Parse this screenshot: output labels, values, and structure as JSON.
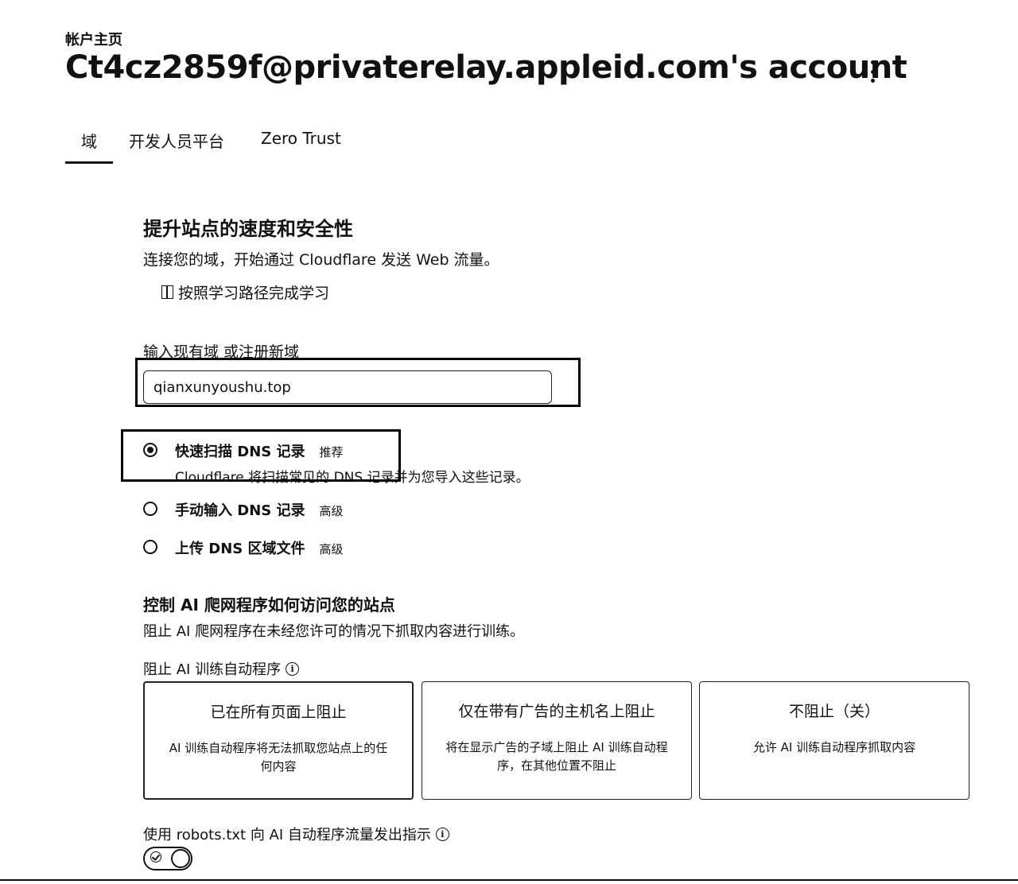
{
  "header": {
    "breadcrumb": "帐户主页",
    "title": "Ct4cz2859f@privaterelay.appleid.com's account",
    "menu_icon": "kebab-icon"
  },
  "tabs": [
    {
      "label": "域",
      "active": true
    },
    {
      "label": "开发人员平台",
      "active": false
    },
    {
      "label": "Zero Trust",
      "active": false
    }
  ],
  "onboarding": {
    "title": "提升站点的速度和安全性",
    "subtitle": "连接您的域，开始通过 Cloudflare 发送 Web 流量。",
    "learn_link": "按照学习路径完成学习",
    "learn_icon": "book-icon",
    "domain_label": "输入现有域 或注册新域",
    "domain_value": "qianxunyoushu.top"
  },
  "dns_options": [
    {
      "title": "快速扫描 DNS 记录",
      "tag": "推荐",
      "desc": "Cloudflare 将扫描常见的 DNS 记录并为您导入这些记录。",
      "selected": true
    },
    {
      "title": "手动输入 DNS 记录",
      "tag": "高级",
      "selected": false
    },
    {
      "title": "上传 DNS 区域文件",
      "tag": "高级",
      "selected": false
    }
  ],
  "ai": {
    "title": "控制 AI 爬网程序如何访问您的站点",
    "subtitle": "阻止 AI 爬网程序在未经您许可的情况下抓取内容进行训练。",
    "bots_label": "阻止 AI 训练自动程序",
    "info_icon": "info-icon",
    "cards": [
      {
        "title": "已在所有页面上阻止",
        "desc": "AI 训练自动程序将无法抓取您站点上的任何内容"
      },
      {
        "title": "仅在带有广告的主机名上阻止",
        "desc": "将在显示广告的子域上阻止 AI 训练自动程序，在其他位置不阻止"
      },
      {
        "title": "不阻止（关）",
        "desc": "允许 AI 训练自动程序抓取内容"
      }
    ],
    "robots_label": "使用 robots.txt 向 AI 自动程序流量发出指示",
    "robots_enabled": true
  }
}
